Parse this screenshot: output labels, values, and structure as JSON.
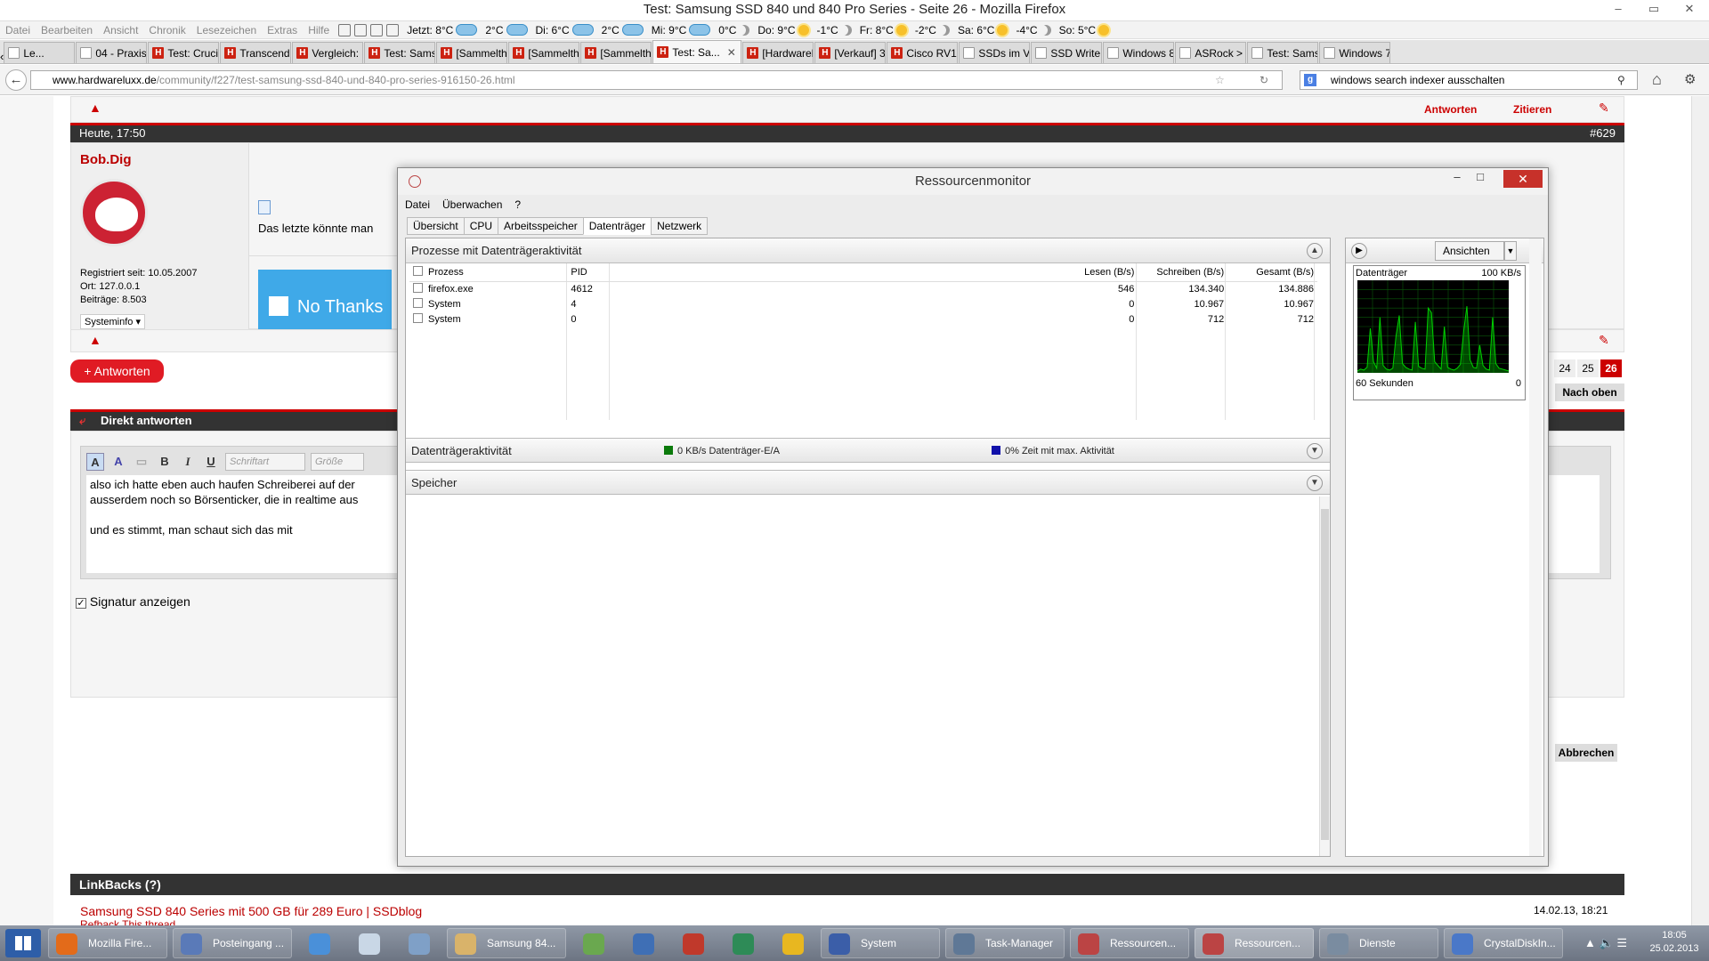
{
  "window": {
    "title": "Test: Samsung SSD 840 und 840 Pro Series - Seite 26 - Mozilla Firefox",
    "min": "–",
    "max": "▭",
    "close": "✕"
  },
  "menubar": {
    "items": [
      "Datei",
      "Bearbeiten",
      "Ansicht",
      "Chronik",
      "Lesezeichen",
      "Extras",
      "Hilfe"
    ],
    "weather": [
      {
        "label": "Jetzt: 8°C",
        "icon": "cloud"
      },
      {
        "label": "2°C",
        "icon": "cloud"
      },
      {
        "label": "Di: 6°C",
        "icon": "cloud"
      },
      {
        "label": "2°C",
        "icon": "cloud"
      },
      {
        "label": "Mi: 9°C",
        "icon": "cloud"
      },
      {
        "label": "0°C",
        "icon": "moon"
      },
      {
        "label": "Do: 9°C",
        "icon": "sun"
      },
      {
        "label": "-1°C",
        "icon": "moon"
      },
      {
        "label": "Fr: 8°C",
        "icon": "sun"
      },
      {
        "label": "-2°C",
        "icon": "moon"
      },
      {
        "label": "Sa: 6°C",
        "icon": "sun"
      },
      {
        "label": "-4°C",
        "icon": "moon"
      },
      {
        "label": "So: 5°C",
        "icon": "sun"
      }
    ]
  },
  "tabs": [
    {
      "label": "Le...",
      "fav": "grey"
    },
    {
      "label": "04 - Praxiste...",
      "fav": "grey"
    },
    {
      "label": "Test: Crucia...",
      "fav": "H"
    },
    {
      "label": "Transcend ...",
      "fav": "H"
    },
    {
      "label": "Vergleich: S...",
      "fav": "H"
    },
    {
      "label": "Test: Samsu...",
      "fav": "H"
    },
    {
      "label": "[Sammelthr...",
      "fav": "H"
    },
    {
      "label": "[Sammelthr...",
      "fav": "H"
    },
    {
      "label": "[Sammelthr...",
      "fav": "H"
    },
    {
      "label": "Test: Sa...",
      "fav": "H",
      "active": true
    },
    {
      "label": "[Hardwarel...",
      "fav": "H"
    },
    {
      "label": "[Verkauf] 32...",
      "fav": "H"
    },
    {
      "label": "Cisco RV180...",
      "fav": "H"
    },
    {
      "label": "SSDs im Ver...",
      "fav": "grey"
    },
    {
      "label": "SSD Write E...",
      "fav": "grey"
    },
    {
      "label": "Windows 8 ...",
      "fav": "grey"
    },
    {
      "label": "ASRock > Z...",
      "fav": "grey"
    },
    {
      "label": "Test: Samsu...",
      "fav": "grey"
    },
    {
      "label": "Windows 7 ...",
      "fav": "grey"
    }
  ],
  "nav": {
    "url_host": "www.hardwareluxx.de",
    "url_path": "/community/f227/test-samsung-ssd-840-und-840-pro-series-916150-26.html",
    "search_value": "windows search indexer ausschalten",
    "search_engine": "g"
  },
  "forum": {
    "post_date": "Heute, 17:50",
    "post_number": "#629",
    "author": "Bob.Dig",
    "registered": "Registriert seit: 10.05.2007",
    "location": "Ort: 127.0.0.1",
    "posts": "Beiträge: 8.503",
    "sysinfo": "Systeminfo ▾",
    "post_text": "Das letzte könnte man",
    "ad_text": "No Thanks",
    "reply_top": "Antworten",
    "quote_top": "Zitieren",
    "reply_button": "+ Antworten",
    "pages": [
      "24",
      "25",
      "26"
    ],
    "current_page": "26",
    "to_top": "Nach oben",
    "quick_reply_title": "Direkt antworten",
    "font_select": "Schriftart",
    "size_select": "Größe",
    "editor_line1": "also ich hatte eben auch haufen Schreiberei auf der",
    "editor_line2": "ausserdem noch so Börsenticker, die in realtime aus",
    "editor_line3": "und es stimmt, man schaut sich das mit",
    "signature_label": "Signatur anzeigen",
    "cancel": "Abbrechen",
    "linkbacks_title": "LinkBacks (?)",
    "linkback_title": "Samsung SSD 840 Series mit 500 GB für 289 Euro | SSDblog",
    "linkback_date": "14.02.13, 18:21",
    "refback": "Refback This thread"
  },
  "resmon": {
    "title": "Ressourcenmonitor",
    "menu": [
      "Datei",
      "Überwachen",
      "?"
    ],
    "tabs": [
      "Übersicht",
      "CPU",
      "Arbeitsspeicher",
      "Datenträger",
      "Netzwerk"
    ],
    "active_tab": "Datenträger",
    "section_processes": "Prozesse mit Datenträgeraktivität",
    "columns": [
      "Prozess",
      "PID",
      "Lesen (B/s)",
      "Schreiben (B/s)",
      "Gesamt (B/s)"
    ],
    "rows": [
      [
        "firefox.exe",
        "4612",
        "546",
        "134.340",
        "134.886"
      ],
      [
        "System",
        "4",
        "0",
        "10.967",
        "10.967"
      ],
      [
        "System",
        "0",
        "0",
        "712",
        "712"
      ]
    ],
    "section_activity": "Datenträgeraktivität",
    "activity_legend_1": "0 KB/s Datenträger-E/A",
    "activity_legend_1_color": "#0b7a0b",
    "activity_legend_2": "0% Zeit mit max. Aktivität",
    "activity_legend_2_color": "#1111aa",
    "section_storage": "Speicher",
    "views_button": "Ansichten",
    "graph_title": "Datenträger",
    "graph_max": "100 KB/s",
    "graph_time": "60 Sekunden",
    "graph_min": "0",
    "graph_color": "#00d000",
    "graph_activity": [
      2,
      4,
      3,
      6,
      48,
      12,
      5,
      60,
      8,
      4,
      3,
      5,
      40,
      62,
      10,
      6,
      4,
      3,
      55,
      7,
      5,
      4,
      70,
      65,
      12,
      8,
      4,
      50,
      6,
      4,
      3,
      5,
      9,
      45,
      72,
      14,
      6,
      5,
      30,
      8,
      4,
      3,
      60,
      10,
      5,
      4,
      3,
      2
    ]
  },
  "taskbar": {
    "items": [
      {
        "label": "Mozilla Fire...",
        "color": "#e36b1a"
      },
      {
        "label": "Posteingang ...",
        "color": "#5a7ab8"
      },
      {
        "label": "",
        "color": "#4a90d9",
        "pin": true
      },
      {
        "label": "",
        "color": "#c9d7e6",
        "pin": true
      },
      {
        "label": "",
        "color": "#7fa0c7",
        "pin": true
      },
      {
        "label": "Samsung 84...",
        "color": "#d9b36a"
      },
      {
        "label": "",
        "color": "#6aa84f",
        "pin": true
      },
      {
        "label": "",
        "color": "#3f6fb5",
        "pin": true
      },
      {
        "label": "",
        "color": "#c0392b",
        "pin": true
      },
      {
        "label": "",
        "color": "#2e8b57",
        "pin": true
      },
      {
        "label": "",
        "color": "#e8b720",
        "pin": true
      },
      {
        "label": "System",
        "color": "#3b5ea8"
      },
      {
        "label": "Task-Manager",
        "color": "#5f7896"
      },
      {
        "label": "Ressourcen...",
        "color": "#b44"
      },
      {
        "label": "Ressourcen...",
        "color": "#b44",
        "active": true
      },
      {
        "label": "Dienste",
        "color": "#7a8ca0"
      },
      {
        "label": "CrystalDiskIn...",
        "color": "#4a78c8"
      }
    ],
    "time": "18:05",
    "date": "25.02.2013"
  }
}
